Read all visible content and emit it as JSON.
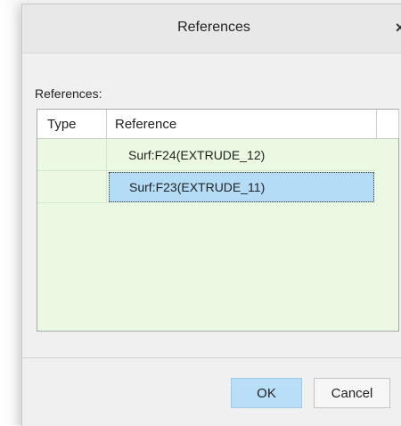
{
  "dialog": {
    "title": "References",
    "close_glyph": "×"
  },
  "references_label": "References:",
  "table": {
    "columns": [
      "Type",
      "Reference"
    ],
    "rows": [
      {
        "type": "",
        "reference": "Surf:F24(EXTRUDE_12)",
        "selected": false
      },
      {
        "type": "",
        "reference": "Surf:F23(EXTRUDE_11)",
        "selected": true
      }
    ]
  },
  "buttons": {
    "ok_label": "OK",
    "cancel_label": "Cancel"
  },
  "colors": {
    "table_background": "#ecf9e2",
    "selected_row": "#b5dcf7",
    "ok_button": "#b8def8"
  }
}
